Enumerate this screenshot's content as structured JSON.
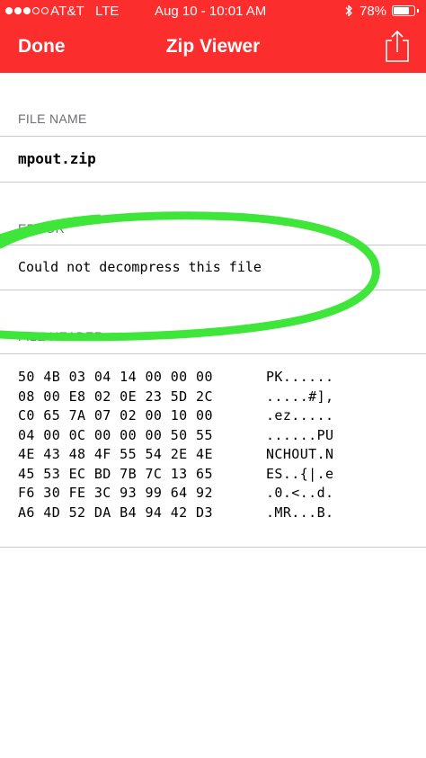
{
  "status_bar": {
    "signal_bars_filled": 3,
    "signal_bars_total": 5,
    "carrier": "AT&T",
    "network": "LTE",
    "datetime": "Aug 10 - 10:01 AM",
    "battery_percent_label": "78%",
    "battery_level": 0.78
  },
  "nav": {
    "done_label": "Done",
    "title": "Zip Viewer",
    "share_icon": "share-icon"
  },
  "sections": {
    "file_name": {
      "header": "FILE NAME",
      "value": "mpout.zip"
    },
    "error": {
      "header": "ERROR",
      "value": "Could not decompress this file"
    },
    "file_header": {
      "header": "FILE HEADER",
      "rows": [
        {
          "bytes": "50 4B 03 04 14 00 00 00",
          "ascii": "PK......"
        },
        {
          "bytes": "08 00 E8 02 0E 23 5D 2C",
          "ascii": ".....#],"
        },
        {
          "bytes": "C0 65 7A 07 02 00 10 00",
          "ascii": ".ez....."
        },
        {
          "bytes": "04 00 0C 00 00 00 50 55",
          "ascii": "......PU"
        },
        {
          "bytes": "4E 43 48 4F 55 54 2E 4E",
          "ascii": "NCHOUT.N"
        },
        {
          "bytes": "45 53 EC BD 7B 7C 13 65",
          "ascii": "ES..{|.e"
        },
        {
          "bytes": "F6 30 FE 3C 93 99 64 92",
          "ascii": ".0.<..d."
        },
        {
          "bytes": "A6 4D 52 DA B4 94 42 D3",
          "ascii": ".MR...B."
        }
      ]
    }
  },
  "colors": {
    "accent": "#fb2d2d",
    "annotation": "#3ee63a",
    "section_header_text": "#6d6d72",
    "divider": "#c8c7cc"
  }
}
